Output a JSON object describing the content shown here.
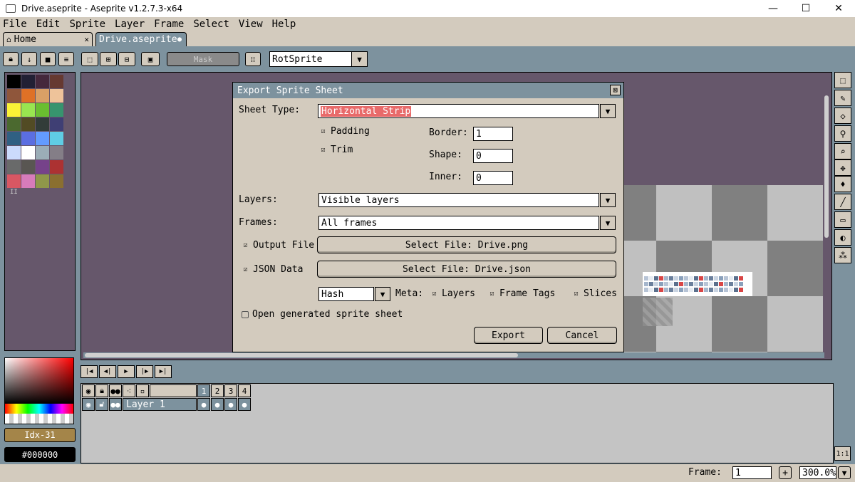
{
  "window": {
    "title": "Drive.aseprite - Aseprite v1.2.7.3-x64",
    "min": "—",
    "max": "☐",
    "close": "✕"
  },
  "menu": [
    "File",
    "Edit",
    "Sprite",
    "Layer",
    "Frame",
    "Select",
    "View",
    "Help"
  ],
  "tabs": {
    "home": "Home",
    "file": "Drive.aseprite"
  },
  "toolbar": {
    "mask_label": "Mask",
    "rotation_algorithm": "RotSprite"
  },
  "palette": {
    "colors": [
      "#000000",
      "#222034",
      "#45283c",
      "#663931",
      "#8f563b",
      "#df7126",
      "#d9a066",
      "#eec39a",
      "#fbf236",
      "#99e550",
      "#6abe30",
      "#37946e",
      "#4b692f",
      "#524b24",
      "#323c39",
      "#3f3f74",
      "#306082",
      "#5b6ee1",
      "#639bff",
      "#5fcde4",
      "#cbdbfc",
      "#ffffff",
      "#9badb7",
      "#847e87",
      "#696a6a",
      "#595652",
      "#76428a",
      "#ac3232",
      "#d95763",
      "#d77bba",
      "#8f974a",
      "#8a6f30"
    ],
    "page_marker": "II"
  },
  "dialog": {
    "title": "Export Sprite Sheet",
    "close": "⊠",
    "sheet_type_label": "Sheet Type:",
    "sheet_type_value": "Horizontal Strip",
    "padding_label": "Padding",
    "trim_label": "Trim",
    "border_label": "Border:",
    "border_value": "1",
    "shape_label": "Shape:",
    "shape_value": "0",
    "inner_label": "Inner:",
    "inner_value": "0",
    "layers_label": "Layers:",
    "layers_value": "Visible layers",
    "frames_label": "Frames:",
    "frames_value": "All frames",
    "output_file_label": "Output File",
    "output_file_button": "Select File: Drive.png",
    "json_data_label": "JSON Data",
    "json_data_button": "Select File: Drive.json",
    "json_format": "Hash",
    "meta_label": "Meta:",
    "meta_layers": "Layers",
    "meta_frame_tags": "Frame Tags",
    "meta_slices": "Slices",
    "open_generated_label": "Open generated sprite sheet",
    "export_button": "Export",
    "cancel_button": "Cancel"
  },
  "color_bar": {
    "index_label": "Idx-31",
    "hex_label": "#000000"
  },
  "timeline": {
    "frames": [
      "1",
      "2",
      "3",
      "4"
    ],
    "layer_name": "Layer 1"
  },
  "status": {
    "frame_label": "Frame:",
    "frame_value": "1",
    "plus": "+",
    "zoom": "300.0%"
  },
  "one_to_one": "1:1"
}
